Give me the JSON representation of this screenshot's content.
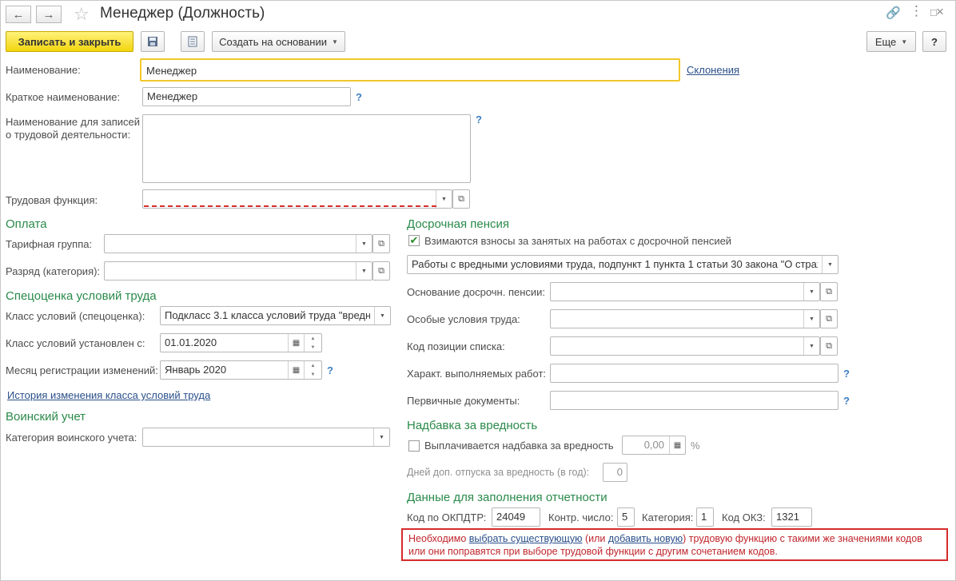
{
  "window": {
    "title": "Менеджер (Должность)",
    "back_icon": "back-arrow-icon",
    "forward_icon": "forward-arrow-icon"
  },
  "toolbar": {
    "save_close_label": "Записать и закрыть",
    "create_basis_label": "Создать на основании",
    "more_label": "Еще",
    "help_label": "?"
  },
  "form": {
    "name_label": "Наименование:",
    "name_value": "Менеджер",
    "declensions_link": "Склонения",
    "short_name_label": "Краткое наименование:",
    "short_name_value": "Менеджер",
    "labor_records_label_1": "Наименование для записей",
    "labor_records_label_2": "о трудовой деятельности:",
    "labor_records_value": "",
    "labor_function_label": "Трудовая функция:",
    "labor_function_value": ""
  },
  "payment": {
    "title": "Оплата",
    "tariff_group_label": "Тарифная группа:",
    "tariff_group_value": "",
    "grade_label": "Разряд (категория):",
    "grade_value": ""
  },
  "special_assessment": {
    "title": "Спецоценка условий труда",
    "class_label": "Класс условий (спецоценка):",
    "class_value": "Подкласс 3.1 класса условий труда \"вредн",
    "class_set_label": "Класс условий установлен с:",
    "class_set_value": "01.01.2020",
    "month_reg_label": "Месяц регистрации изменений:",
    "month_reg_value": "Январь 2020",
    "history_link": "История изменения класса условий труда"
  },
  "military": {
    "title": "Воинский учет",
    "category_label": "Категория воинского учета:",
    "category_value": ""
  },
  "early_pension": {
    "title": "Досрочная пенсия",
    "contributions_checkbox_label": "Взимаются взносы за занятых на работах с досрочной пенсией",
    "contributions_checked": true,
    "work_type_value": "Работы с вредными условиями труда, подпункт 1 пункта 1 статьи 30 закона \"О страх",
    "basis_label": "Основание досрочн. пенсии:",
    "basis_value": "",
    "special_conditions_label": "Особые условия труда:",
    "special_conditions_value": "",
    "position_code_label": "Код позиции списка:",
    "position_code_value": "",
    "work_character_label": "Характ. выполняемых работ:",
    "work_character_value": "",
    "primary_docs_label": "Первичные документы:",
    "primary_docs_value": ""
  },
  "hazard_bonus": {
    "title": "Надбавка за вредность",
    "paid_checkbox_label": "Выплачивается надбавка за вредность",
    "paid_checked": false,
    "percent_value": "0,00",
    "percent_sign": "%",
    "extra_leave_label": "Дней доп. отпуска за вредность (в год):",
    "extra_leave_value": "0"
  },
  "reporting": {
    "title": "Данные для заполнения отчетности",
    "okpdtr_label": "Код по ОКПДТР:",
    "okpdtr_value": "24049",
    "control_label": "Контр. число:",
    "control_value": "5",
    "category_label": "Категория:",
    "category_value": "1",
    "okz_label": "Код ОКЗ:",
    "okz_value": "1321"
  },
  "notice": {
    "part1": "Необходимо ",
    "link1": "выбрать существующую",
    "part2": " (или ",
    "link2": "добавить новую",
    "part3": ") трудовую функцию с такими же значениями кодов",
    "line2": "или они поправятся при выборе трудовой функции с другим сочетанием кодов."
  },
  "colors": {
    "accent_green": "#2a8a4a",
    "primary_button": "#f2d50f",
    "error_red": "#d62b2b",
    "link_blue": "#2a4f8a"
  }
}
